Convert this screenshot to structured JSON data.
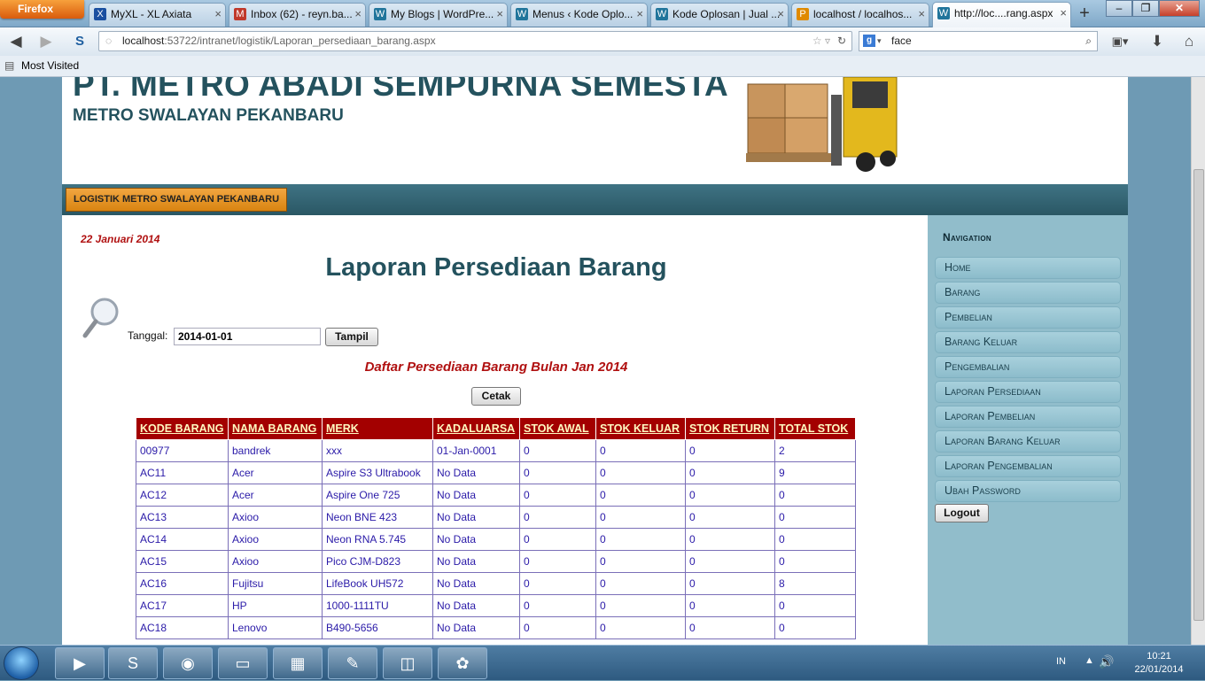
{
  "browser": {
    "menu_button": "Firefox",
    "tabs": [
      {
        "label": "MyXL - XL Axiata",
        "icon": "xl-icon",
        "color": "#1a4fa0"
      },
      {
        "label": "Inbox (62) - reyn.ba...",
        "icon": "gmail-icon",
        "color": "#c0392b"
      },
      {
        "label": "My Blogs | WordPre...",
        "icon": "wordpress-icon",
        "color": "#21759b"
      },
      {
        "label": "Menus ‹ Kode Oplo...",
        "icon": "wordpress-icon",
        "color": "#21759b"
      },
      {
        "label": "Kode Oplosan | Jual ...",
        "icon": "wordpress-icon",
        "color": "#21759b"
      },
      {
        "label": "localhost / localhos...",
        "icon": "phpmyadmin-icon",
        "color": "#e08a00"
      },
      {
        "label": "http://loc....rang.aspx",
        "icon": "wordpress-icon",
        "color": "#21759b"
      }
    ],
    "url_host": "localhost",
    "url_rest": ":53722/intranet/logistik/Laporan_persediaan_barang.aspx",
    "search_value": "face",
    "bookmarks_label": "Most Visited"
  },
  "header": {
    "company": "PT. METRO ABADI SEMPURNA SEMESTA",
    "branch": "METRO SWALAYAN PEKANBARU"
  },
  "menu": {
    "label": "LOGISTIK METRO SWALAYAN PEKANBARU"
  },
  "main": {
    "date": "22 Januari 2014",
    "title": "Laporan Persediaan Barang",
    "tanggal_label": "Tanggal:",
    "tanggal_value": "2014-01-01",
    "tampil_label": "Tampil",
    "subtitle": "Daftar Persediaan Barang Bulan Jan 2014",
    "cetak_label": "Cetak",
    "columns": [
      "KODE BARANG",
      "NAMA BARANG",
      "MERK",
      "KADALUARSA",
      "STOK AWAL",
      "STOK KELUAR",
      "STOK RETURN",
      "TOTAL STOK"
    ],
    "rows": [
      [
        "00977",
        "bandrek",
        "xxx",
        "01-Jan-0001",
        "0",
        "0",
        "0",
        "2"
      ],
      [
        "AC11",
        "Acer",
        "Aspire S3 Ultrabook",
        "No Data",
        "0",
        "0",
        "0",
        "9"
      ],
      [
        "AC12",
        "Acer",
        "Aspire One 725",
        "No Data",
        "0",
        "0",
        "0",
        "0"
      ],
      [
        "AC13",
        "Axioo",
        "Neon BNE 423",
        "No Data",
        "0",
        "0",
        "0",
        "0"
      ],
      [
        "AC14",
        "Axioo",
        "Neon RNA 5.745",
        "No Data",
        "0",
        "0",
        "0",
        "0"
      ],
      [
        "AC15",
        "Axioo",
        "Pico CJM-D823",
        "No Data",
        "0",
        "0",
        "0",
        "0"
      ],
      [
        "AC16",
        "Fujitsu",
        "LifeBook UH572",
        "No Data",
        "0",
        "0",
        "0",
        "8"
      ],
      [
        "AC17",
        "HP",
        "1000-1111TU",
        "No Data",
        "0",
        "0",
        "0",
        "0"
      ],
      [
        "AC18",
        "Lenovo",
        "B490-5656",
        "No Data",
        "0",
        "0",
        "0",
        "0"
      ]
    ]
  },
  "sidebar": {
    "heading": "Navigation",
    "items": [
      "Home",
      "Barang",
      "Pembelian",
      "Barang Keluar",
      "Pengembalian",
      "Laporan Persediaan",
      "Laporan Pembelian",
      "Laporan Barang Keluar",
      "Laporan Pengembalian",
      "Ubah Password"
    ],
    "logout_label": "Logout"
  },
  "taskbar": {
    "language": "IN",
    "time": "10:21",
    "date": "22/01/2014"
  }
}
